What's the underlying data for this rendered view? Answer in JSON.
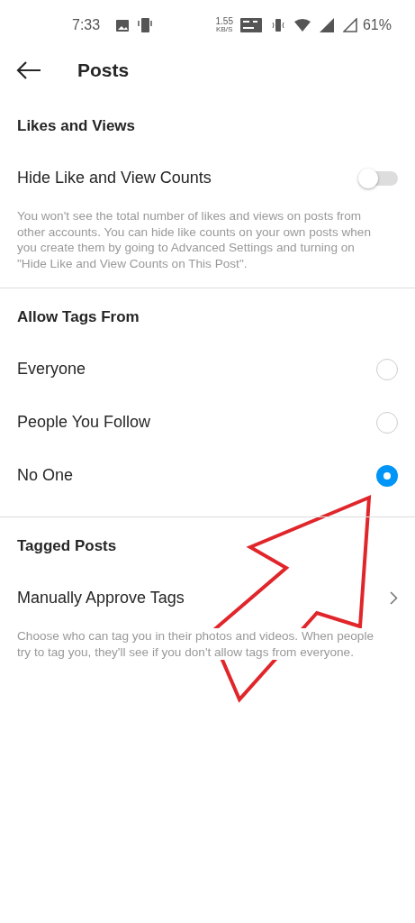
{
  "status_bar": {
    "time": "7:33",
    "speed": "1.55",
    "speed_unit": "KB/S",
    "battery": "61%"
  },
  "header": {
    "title": "Posts"
  },
  "sections": [
    {
      "title": "Likes and Views",
      "rows": [
        {
          "kind": "toggle",
          "label": "Hide Like and View Counts",
          "on": false
        }
      ],
      "note": "You won't see the total number of likes and views on posts from other accounts. You can hide like counts on your own posts when you create them by going to Advanced Settings and turning on \"Hide Like and View Counts on This Post\"."
    },
    {
      "title": "Allow Tags From",
      "rows": [
        {
          "kind": "radio",
          "label": "Everyone",
          "selected": false
        },
        {
          "kind": "radio",
          "label": "People You Follow",
          "selected": false
        },
        {
          "kind": "radio",
          "label": "No One",
          "selected": true
        }
      ]
    },
    {
      "title": "Tagged Posts",
      "rows": [
        {
          "kind": "link",
          "label": "Manually Approve Tags"
        }
      ],
      "note": "Choose who can tag you in their photos and videos. When people try to tag you, they'll see if you don't allow tags from everyone."
    }
  ]
}
